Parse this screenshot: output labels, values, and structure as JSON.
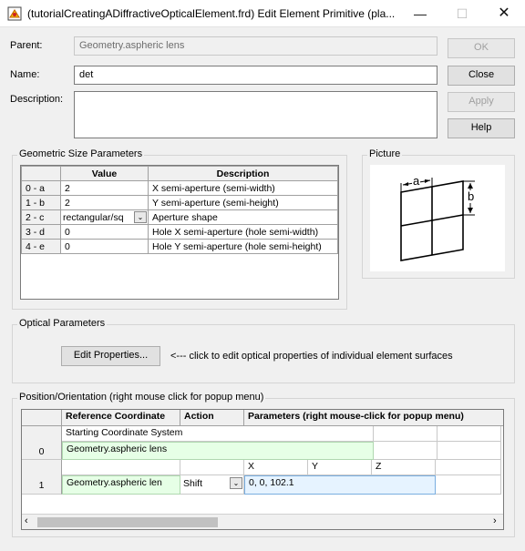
{
  "window": {
    "title": "(tutorialCreatingADiffractiveOpticalElement.frd) Edit Element Primitive (pla...",
    "icon": "app-icon"
  },
  "form": {
    "parent_label": "Parent:",
    "parent_value": "Geometry.aspheric lens",
    "name_label": "Name:",
    "name_value": "det",
    "description_label": "Description:",
    "description_value": ""
  },
  "buttons": {
    "ok": "OK",
    "close": "Close",
    "apply": "Apply",
    "help": "Help"
  },
  "geometric": {
    "title": "Geometric Size Parameters",
    "headers": [
      "Value",
      "Description"
    ],
    "rows": [
      {
        "id": "0 - a",
        "value": "2",
        "desc": "X semi-aperture (semi-width)"
      },
      {
        "id": "1 - b",
        "value": "2",
        "desc": "Y semi-aperture (semi-height)"
      },
      {
        "id": "2 - c",
        "value": "rectangular/sq",
        "desc": "Aperture shape"
      },
      {
        "id": "3 - d",
        "value": "0",
        "desc": "Hole X semi-aperture (hole semi-width)"
      },
      {
        "id": "4 - e",
        "value": "0",
        "desc": "Hole Y semi-aperture (hole semi-height)"
      }
    ]
  },
  "picture": {
    "title": "Picture",
    "label_a": "a",
    "label_b": "b"
  },
  "optical": {
    "title": "Optical Parameters",
    "edit_button": "Edit Properties...",
    "hint": "<--- click to edit optical properties of individual element surfaces"
  },
  "position": {
    "title": "Position/Orientation  (right mouse click for popup menu)",
    "headers": {
      "reference": "Reference Coordinate",
      "action": "Action",
      "parameters": "Parameters (right mouse-click for popup menu)"
    },
    "row0": {
      "number": "0",
      "line1": "Starting Coordinate System",
      "line2": "Geometry.aspheric lens"
    },
    "row1": {
      "number": "1",
      "axes": [
        "X",
        "Y",
        "Z"
      ],
      "reference": "Geometry.aspheric len",
      "action": "Shift",
      "params": "0,  0,  102.1"
    }
  },
  "colors": {
    "background": "#f0f0f0",
    "green_cell": "#e6ffe6",
    "blue_cell": "#e6f3ff"
  }
}
